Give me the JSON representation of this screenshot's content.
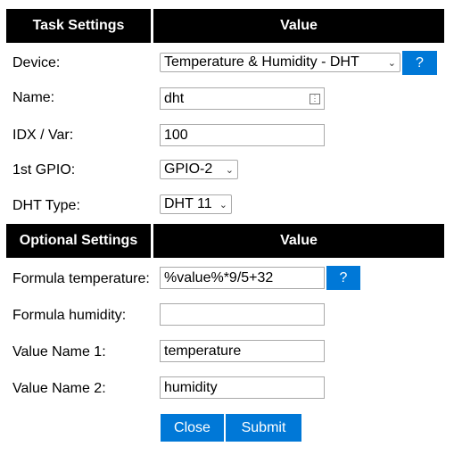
{
  "task_settings": {
    "header_left": "Task Settings",
    "header_right": "Value",
    "device": {
      "label": "Device:",
      "value": "Temperature & Humidity - DHT",
      "help": "?"
    },
    "name": {
      "label": "Name:",
      "value": "dht"
    },
    "idx": {
      "label": "IDX / Var:",
      "value": "100"
    },
    "gpio": {
      "label": "1st GPIO:",
      "value": "GPIO-2"
    },
    "dht_type": {
      "label": "DHT Type:",
      "value": "DHT 11"
    }
  },
  "optional_settings": {
    "header_left": "Optional Settings",
    "header_right": "Value",
    "formula_temperature": {
      "label": "Formula temperature:",
      "value": "%value%*9/5+32",
      "help": "?"
    },
    "formula_humidity": {
      "label": "Formula humidity:",
      "value": ""
    },
    "value_name_1": {
      "label": "Value Name 1:",
      "value": "temperature"
    },
    "value_name_2": {
      "label": "Value Name 2:",
      "value": "humidity"
    }
  },
  "buttons": {
    "close": "Close",
    "submit": "Submit"
  },
  "colors": {
    "header_bg": "#000000",
    "button_bg": "#0078d7",
    "button_text": "#ffffff"
  }
}
